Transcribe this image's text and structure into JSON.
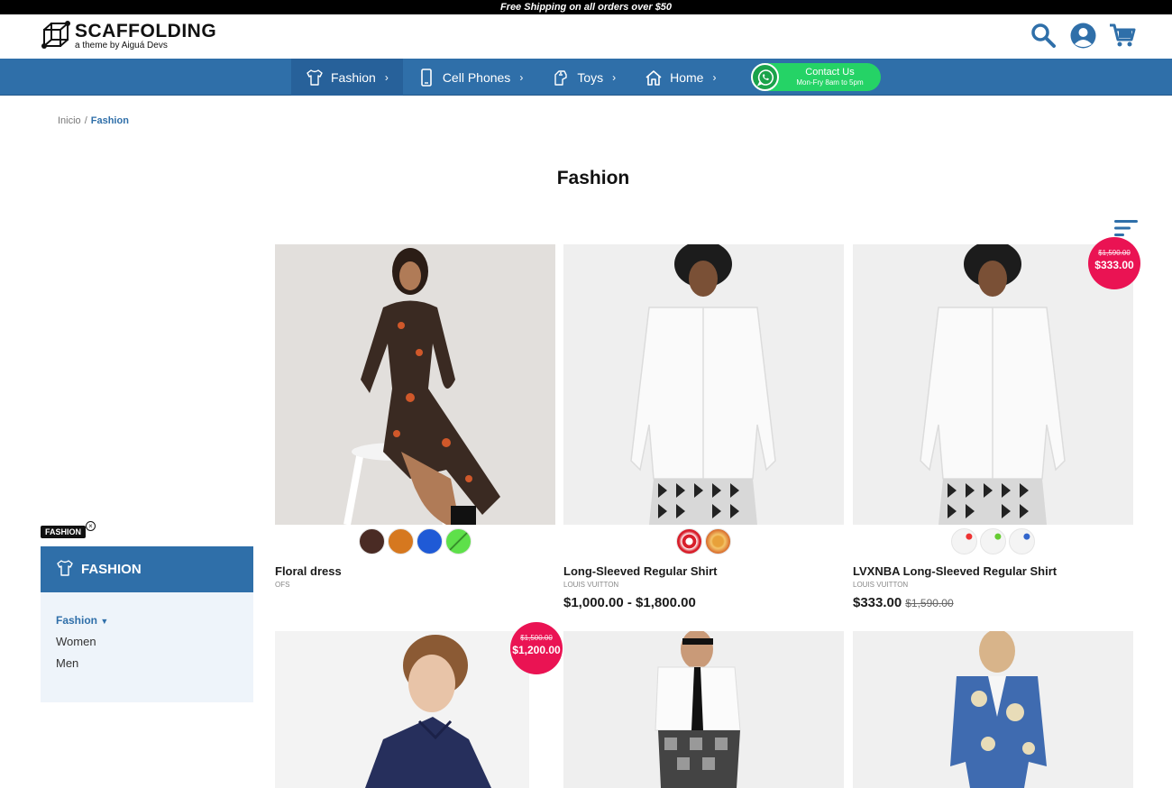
{
  "announcement": "Free Shipping on all orders over $50",
  "brand": {
    "title": "SCAFFOLDING",
    "subtitle": "a theme by Aiguá Devs"
  },
  "header_icons": [
    "search-icon",
    "user-icon",
    "cart-icon"
  ],
  "nav": {
    "items": [
      {
        "label": "Fashion",
        "icon": "shirt-icon"
      },
      {
        "label": "Cell Phones",
        "icon": "phone-icon"
      },
      {
        "label": "Toys",
        "icon": "toy-icon"
      },
      {
        "label": "Home",
        "icon": "home-icon"
      }
    ],
    "chevron": "›",
    "contact": {
      "title": "Contact Us",
      "subtitle": "Mon-Fry 8am to 5pm"
    }
  },
  "breadcrumb": {
    "home": "Inicio",
    "sep": "/",
    "current": "Fashion"
  },
  "page_title": "Fashion",
  "sidebar": {
    "tag": "FASHION",
    "tag_close": "×",
    "heading": "FASHION",
    "parent": "Fashion",
    "links": [
      "Women",
      "Men"
    ]
  },
  "products": [
    {
      "name": "Floral dress",
      "brand": "OFS",
      "price": "",
      "old_price": "",
      "swatches": [
        "#4a2b24",
        "#d6781f",
        "#1f5ad6",
        "#5ee04a"
      ]
    },
    {
      "name": "Long-Sleeved Regular Shirt",
      "brand": "LOUIS VUITTON",
      "price": "$1,000.00 - $1,800.00",
      "old_price": "",
      "swatches": [
        "#d81e2a",
        "#e8a13a"
      ]
    },
    {
      "name": "LVXNBA Long-Sleeved Regular Shirt",
      "brand": "LOUIS VUITTON",
      "price": "$333.00",
      "old_price": "$1,590.00",
      "badge_old": "$1,590.00",
      "badge_new": "$333.00",
      "swatches": [
        "#f2f2f2",
        "#f2f2f2",
        "#f2f2f2"
      ]
    },
    {
      "name": "",
      "brand": "",
      "price": "",
      "old_price": "",
      "badge_old": "$1,500.00",
      "badge_new": "$1,200.00"
    },
    {
      "name": "",
      "brand": "",
      "price": "",
      "old_price": ""
    },
    {
      "name": "",
      "brand": "",
      "price": "",
      "old_price": ""
    }
  ],
  "colors": {
    "primary": "#2f6fa9",
    "sale": "#ea1353",
    "whatsapp": "#25d366"
  }
}
